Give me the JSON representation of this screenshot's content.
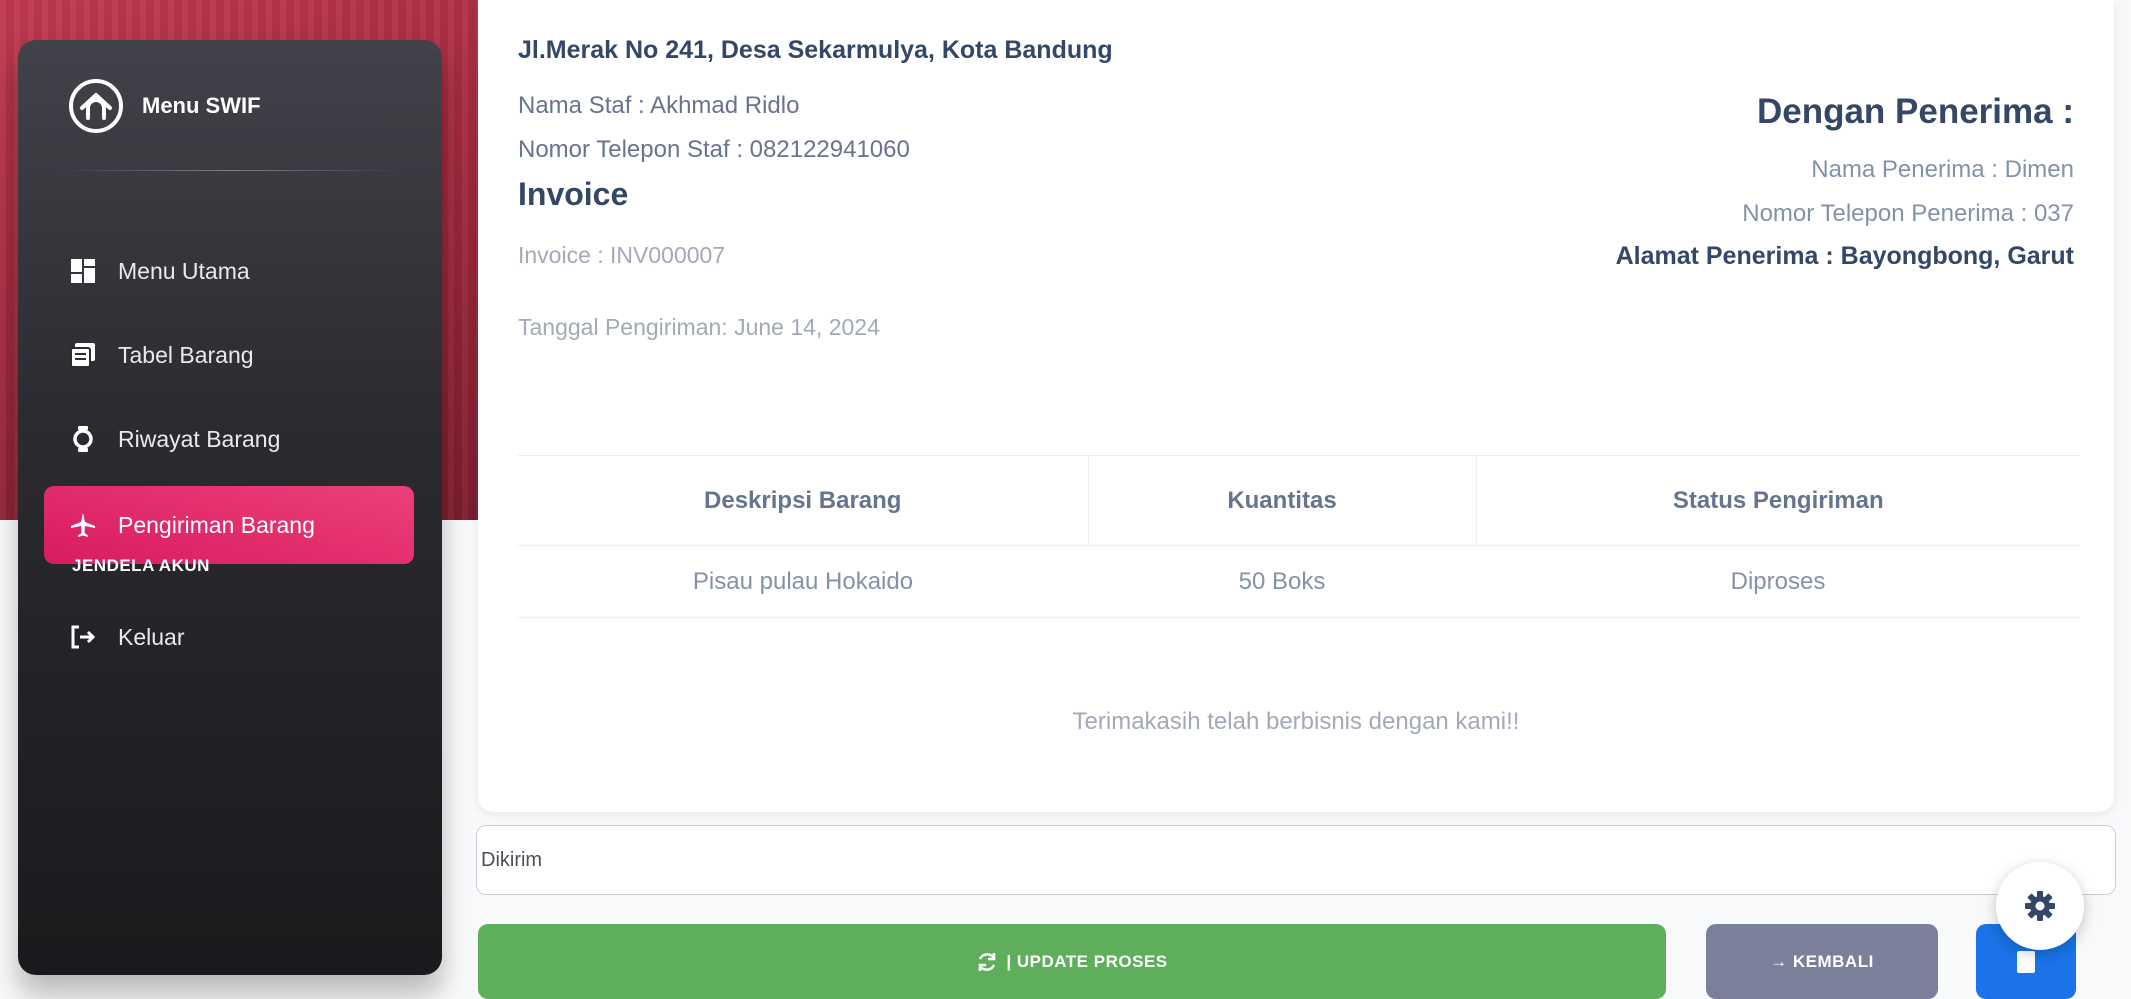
{
  "sidebar": {
    "brand": "Menu SWIF",
    "items": [
      {
        "label": "Menu Utama",
        "icon": "dashboard-icon"
      },
      {
        "label": "Tabel Barang",
        "icon": "table-icon"
      },
      {
        "label": "Riwayat Barang",
        "icon": "history-icon"
      },
      {
        "label": "Pengiriman Barang",
        "icon": "airplane-icon",
        "active": true
      }
    ],
    "section_label": "JENDELA AKUN",
    "logout_label": "Keluar"
  },
  "invoice": {
    "address": "Jl.Merak No 241, Desa Sekarmulya, Kota Bandung",
    "staff_name": "Nama Staf : Akhmad Ridlo",
    "staff_phone": "Nomor Telepon Staf : 082122941060",
    "title": "Invoice",
    "number": "Invoice : INV000007",
    "ship_date": "Tanggal Pengiriman: June 14, 2024",
    "recipient_title": "Dengan Penerima :",
    "recipient_name": "Nama Penerima : Dimen",
    "recipient_phone": "Nomor Telepon Penerima : 037",
    "recipient_address": "Alamat Penerima : Bayongbong, Garut",
    "table": {
      "headers": [
        "Deskripsi Barang",
        "Kuantitas",
        "Status Pengiriman"
      ],
      "rows": [
        [
          "Pisau pulau Hokaido",
          "50 Boks",
          "Diproses"
        ]
      ]
    },
    "thanks": "Terimakasih telah berbisnis dengan kami!!"
  },
  "form": {
    "status_value": "Dikirim",
    "update_label": "| UPDATE PROSES",
    "back_label": "→ KEMBALI"
  },
  "colors": {
    "accent": "#e91e63",
    "sidebar_dark": "#2b2b30",
    "success": "#5fae5c",
    "secondary": "#7b809a",
    "primary": "#1a73e8"
  }
}
